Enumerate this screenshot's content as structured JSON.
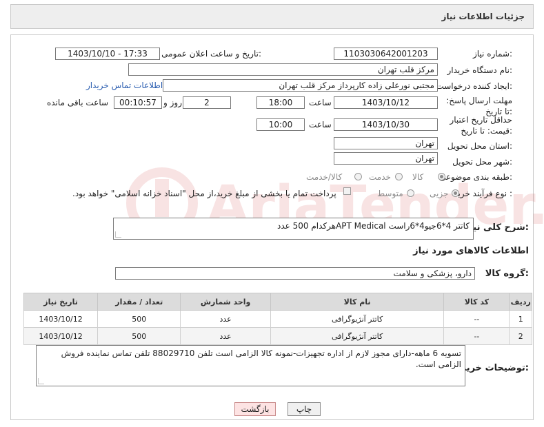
{
  "header": {
    "title": "جزئیات اطلاعات نیاز"
  },
  "need_number": {
    "label": "شماره نیاز:",
    "value": "1103030642001203"
  },
  "announce_datetime": {
    "label": "تاریخ و ساعت اعلان عمومی:",
    "value": "1403/10/10 - 17:33"
  },
  "buyer_org": {
    "label": "نام دستگاه خریدار:",
    "value": "مرکز قلب تهران"
  },
  "requester": {
    "label": "ایجاد کننده درخواست:",
    "value": "مجتبی نورعلی زاده کارپرداز مرکز قلب تهران",
    "contact_link": "اطلاعات تماس خریدار"
  },
  "reply_deadline": {
    "label": "مهلت ارسال پاسخ: تا تاریخ:",
    "date": "1403/10/12",
    "time_label": "ساعت",
    "time": "18:00",
    "days": "2",
    "days_label": "روز و",
    "remaining": "00:10:57",
    "remaining_label": "ساعت باقی مانده"
  },
  "price_validity": {
    "label": "حداقل تاریخ اعتبار قیمت: تا تاریخ:",
    "date": "1403/10/30",
    "time_label": "ساعت",
    "time": "10:00"
  },
  "province": {
    "label": "استان محل تحویل:",
    "value": "تهران"
  },
  "city": {
    "label": "شهر محل تحویل:",
    "value": "تهران"
  },
  "category": {
    "label": "طبقه بندی موضوعی:",
    "options": [
      "کالا",
      "خدمت",
      "کالا/خدمت"
    ]
  },
  "purchase_type": {
    "label": "نوع فرآیند خرید :",
    "options": [
      "جزیی",
      "متوسط"
    ],
    "treasury_note": "پرداخت تمام یا بخشی از مبلغ خرید،از محل \"اسناد خزانه اسلامی\" خواهد بود."
  },
  "description": {
    "label": "شرح کلی نیاز:",
    "value": "کاتتر 4*6جیو4*6راست APT Medicalهرکدام 500 عدد"
  },
  "goods_info": {
    "label": "اطلاعات کالاهای مورد نیاز"
  },
  "goods_group": {
    "label": "گروه کالا:",
    "value": "دارو، پزشکی و سلامت"
  },
  "table": {
    "headers": [
      "ردیف",
      "کد کالا",
      "نام کالا",
      "واحد شمارش",
      "تعداد / مقدار",
      "تاریخ نیاز"
    ],
    "rows": [
      [
        "1",
        "--",
        "کاتتر آنژیوگرافی",
        "عدد",
        "500",
        "1403/10/12"
      ],
      [
        "2",
        "--",
        "کاتتر آنژیوگرافی",
        "عدد",
        "500",
        "1403/10/12"
      ]
    ]
  },
  "buyer_notes": {
    "label": "توضیحات خریدار:",
    "value": "تسویه 6 ماهه-دارای مجوز لازم از اداره تجهیزات-نمونه کالا الزامی است تلفن 88029710 تلفن تماس نماینده فروش الزامی است."
  },
  "buttons": {
    "print": "چاپ",
    "back": "بازگشت"
  },
  "colors": {
    "link": "#2a5db0",
    "back_button": "#fde3e3",
    "header_bg": "#eeeeee"
  }
}
